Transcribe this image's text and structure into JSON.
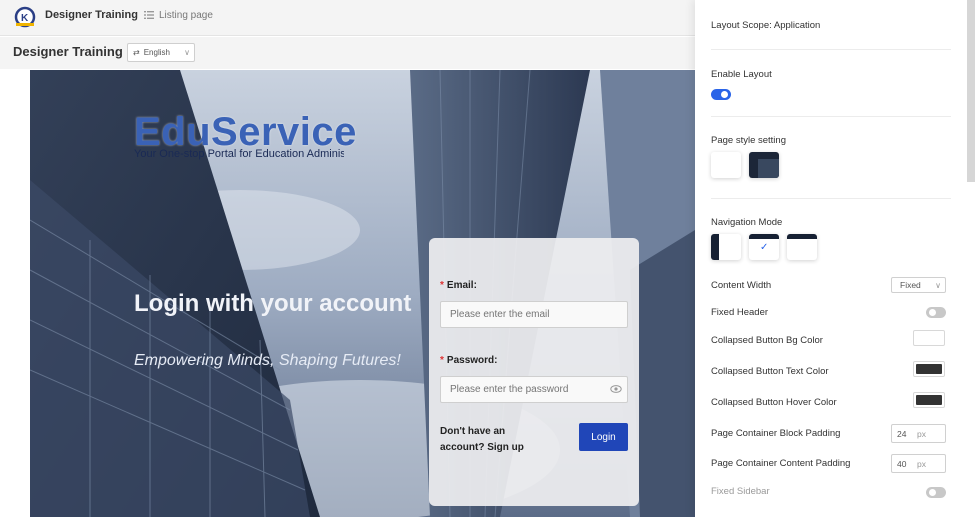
{
  "header": {
    "app_title": "Designer Training",
    "nav_item": "Listing page"
  },
  "subheader": {
    "page_title": "Designer Training",
    "language": "English"
  },
  "hero": {
    "brand": "EduService",
    "brand_subtitle": "Your One-stop Portal for Education Administration",
    "heading": "Login with your account",
    "tagline": "Empowering Minds, Shaping Futures!"
  },
  "login": {
    "email_label": "Email:",
    "email_placeholder": "Please enter the email",
    "password_label": "Password:",
    "password_placeholder": "Please enter the password",
    "signup_text": "Don't have an account? Sign up",
    "login_button": "Login"
  },
  "settings": {
    "layout_scope": "Layout Scope: Application",
    "enable_layout": "Enable Layout",
    "enable_layout_on": true,
    "page_style": "Page style setting",
    "navigation_mode": "Navigation Mode",
    "content_width_label": "Content Width",
    "content_width_value": "Fixed",
    "fixed_header": "Fixed Header",
    "fixed_header_on": false,
    "collapsed_bg": "Collapsed Button Bg Color",
    "collapsed_bg_color": "#ffffff",
    "collapsed_text": "Collapsed Button Text Color",
    "collapsed_text_color": "#333333",
    "collapsed_hover": "Collapsed Button Hover Color",
    "collapsed_hover_color": "#333333",
    "block_padding": "Page Container Block Padding",
    "block_padding_value": "24",
    "content_padding": "Page Container Content Padding",
    "content_padding_value": "40",
    "unit": "px",
    "fixed_sidebar": "Fixed Sidebar",
    "fixed_sidebar_on": false
  },
  "colors": {
    "primary": "#2046b8",
    "toggle_on": "#2a64e8",
    "brand_blue": "#3a62b6"
  }
}
